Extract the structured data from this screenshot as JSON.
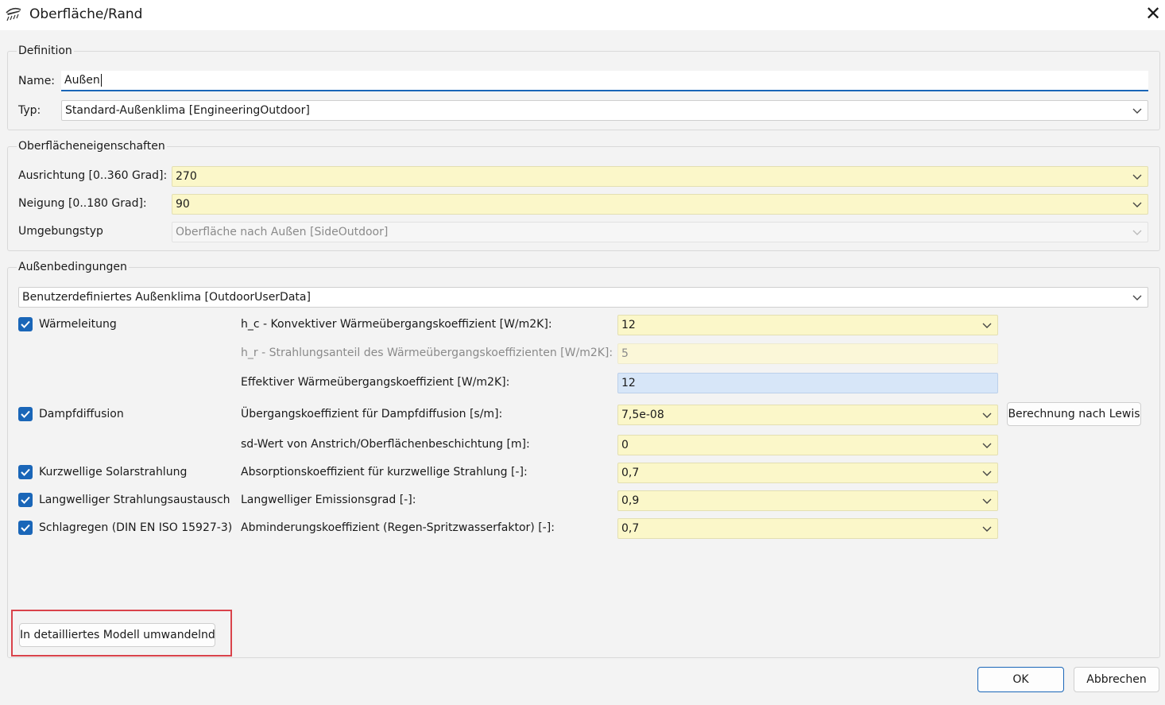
{
  "window": {
    "title": "Oberfläche/Rand"
  },
  "definition": {
    "group_title": "Definition",
    "name_label": "Name:",
    "name_value": "Außen",
    "type_label": "Typ:",
    "type_value": "Standard-Außenklima [EngineeringOutdoor]"
  },
  "surface": {
    "group_title": "Oberflächeneigenschaften",
    "orientation_label": "Ausrichtung [0..360 Grad]:",
    "orientation_value": "270",
    "inclination_label": "Neigung [0..180 Grad]:",
    "inclination_value": "90",
    "env_label": "Umgebungstyp",
    "env_value": "Oberfläche nach Außen [SideOutdoor]"
  },
  "outdoor": {
    "group_title": "Außenbedingungen",
    "climate_value": "Benutzerdefiniertes Außenklima [OutdoorUserData]",
    "heat_conduction": {
      "checkbox_label": "Wärmeleitung",
      "checked": true,
      "hc_label": "h_c - Konvektiver Wärmeübergangskoeffizient [W/m2K]:",
      "hc_value": "12",
      "hr_label": "h_r - Strahlungsanteil des Wärmeübergangskoeffizienten [W/m2K]:",
      "hr_value": "5",
      "eff_label": "Effektiver Wärmeübergangskoeffizient [W/m2K]:",
      "eff_value": "12"
    },
    "vapor": {
      "checkbox_label": "Dampfdiffusion",
      "checked": true,
      "coef_label": "Übergangskoeffizient für Dampfdiffusion [s/m]:",
      "coef_value": "7,5e-08",
      "lewis_button": "Berechnung nach Lewis",
      "sd_label": "sd-Wert von Anstrich/Oberflächenbeschichtung [m]:",
      "sd_value": "0"
    },
    "solar": {
      "checkbox_label": "Kurzwellige Solarstrahlung",
      "checked": true,
      "abs_label": "Absorptionskoeffizient für kurzwellige Strahlung [-]:",
      "abs_value": "0,7"
    },
    "longwave": {
      "checkbox_label": "Langwelliger Strahlungsaustausch",
      "checked": true,
      "emis_label": "Langwelliger Emissionsgrad [-]:",
      "emis_value": "0,9"
    },
    "rain": {
      "checkbox_label": "Schlagregen (DIN EN ISO 15927-3)",
      "checked": true,
      "reduction_label": "Abminderungskoeffizient (Regen-Spritzwasserfaktor) [-]:",
      "reduction_value": "0,7"
    },
    "convert_button": "In detailliertes Modell umwandelnd"
  },
  "footer": {
    "ok": "OK",
    "cancel": "Abbrechen"
  },
  "colors": {
    "accent": "#1a66b8",
    "input_yellow": "#fbf7c9",
    "input_blue": "#d7e6f8",
    "highlight": "#d9434b"
  }
}
